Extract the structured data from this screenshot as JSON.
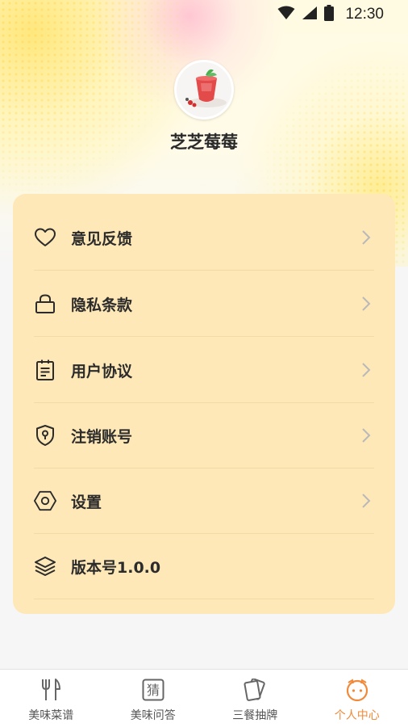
{
  "status_bar": {
    "time": "12:30",
    "icons": [
      "wifi-icon",
      "signal-icon",
      "battery-icon"
    ]
  },
  "profile": {
    "username": "芝芝莓莓",
    "avatar": "avatar-image"
  },
  "menu": {
    "items": [
      {
        "label": "意见反馈",
        "icon": "heart-icon",
        "has_chevron": true
      },
      {
        "label": "隐私条款",
        "icon": "lock-icon",
        "has_chevron": true
      },
      {
        "label": "用户协议",
        "icon": "clipboard-icon",
        "has_chevron": true
      },
      {
        "label": "注销账号",
        "icon": "shield-icon",
        "has_chevron": true
      },
      {
        "label": "设置",
        "icon": "settings-hexagon-icon",
        "has_chevron": true
      },
      {
        "label": "版本号1.0.0",
        "icon": "layers-icon",
        "has_chevron": false
      }
    ]
  },
  "tab_bar": {
    "tabs": [
      {
        "label": "美味菜谱",
        "icon": "fork-knife-icon",
        "active": false
      },
      {
        "label": "美味问答",
        "icon": "guess-icon",
        "active": false
      },
      {
        "label": "三餐抽牌",
        "icon": "cards-icon",
        "active": false
      },
      {
        "label": "个人中心",
        "icon": "face-icon",
        "active": true
      }
    ],
    "guess_char": "猜"
  },
  "colors": {
    "card_bg": "#ffe8b7",
    "active_tab": "#f08a3a",
    "text": "#2b2b2b"
  }
}
